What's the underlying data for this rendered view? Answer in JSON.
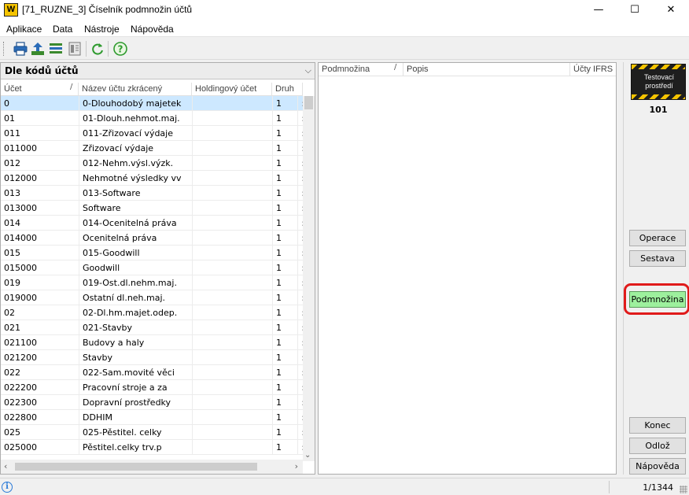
{
  "window": {
    "logo_text": "W",
    "title": "[71_RUZNE_3] Číselník podmnožin účtů",
    "minimize": "—",
    "maximize": "☐",
    "close": "✕"
  },
  "menu": [
    "Aplikace",
    "Data",
    "Nástroje",
    "Nápověda"
  ],
  "toolbar": {
    "icons": [
      "printer-icon",
      "export-icon",
      "list-icon",
      "document-icon",
      "refresh-icon",
      "help-icon"
    ]
  },
  "left": {
    "sort_label": "Dle kódů účtů",
    "columns": {
      "ucet": "Účet",
      "nazev": "Název účtu zkrácený",
      "holding": "Holdingový účet",
      "druh": "Druh"
    },
    "sort_mark": "/",
    "rows": [
      {
        "ucet": "0",
        "nazev": "0-Dlouhodobý majetek",
        "holding": "",
        "druh": "1",
        "extra": ":"
      },
      {
        "ucet": "01",
        "nazev": "01-Dlouh.nehmot.maj.",
        "holding": "",
        "druh": "1",
        "extra": ":"
      },
      {
        "ucet": "011",
        "nazev": "011-Zřizovací výdaje",
        "holding": "",
        "druh": "1",
        "extra": ":"
      },
      {
        "ucet": "011000",
        "nazev": "Zřizovací výdaje",
        "holding": "",
        "druh": "1",
        "extra": ":"
      },
      {
        "ucet": "012",
        "nazev": "012-Nehm.výsl.výzk.",
        "holding": "",
        "druh": "1",
        "extra": ":"
      },
      {
        "ucet": "012000",
        "nazev": "Nehmotné výsledky vv",
        "holding": "",
        "druh": "1",
        "extra": ":"
      },
      {
        "ucet": "013",
        "nazev": "013-Software",
        "holding": "",
        "druh": "1",
        "extra": ":"
      },
      {
        "ucet": "013000",
        "nazev": "Software",
        "holding": "",
        "druh": "1",
        "extra": ":"
      },
      {
        "ucet": "014",
        "nazev": "014-Ocenitelná práva",
        "holding": "",
        "druh": "1",
        "extra": ":"
      },
      {
        "ucet": "014000",
        "nazev": "Ocenitelná práva",
        "holding": "",
        "druh": "1",
        "extra": ":"
      },
      {
        "ucet": "015",
        "nazev": "015-Goodwill",
        "holding": "",
        "druh": "1",
        "extra": ":"
      },
      {
        "ucet": "015000",
        "nazev": "Goodwill",
        "holding": "",
        "druh": "1",
        "extra": ":"
      },
      {
        "ucet": "019",
        "nazev": "019-Ost.dl.nehm.maj.",
        "holding": "",
        "druh": "1",
        "extra": ":"
      },
      {
        "ucet": "019000",
        "nazev": "Ostatní dl.neh.maj.",
        "holding": "",
        "druh": "1",
        "extra": ":"
      },
      {
        "ucet": "02",
        "nazev": "02-Dl.hm.majet.odep.",
        "holding": "",
        "druh": "1",
        "extra": ":"
      },
      {
        "ucet": "021",
        "nazev": "021-Stavby",
        "holding": "",
        "druh": "1",
        "extra": ":"
      },
      {
        "ucet": "021100",
        "nazev": "Budovy a haly",
        "holding": "",
        "druh": "1",
        "extra": ":"
      },
      {
        "ucet": "021200",
        "nazev": "Stavby",
        "holding": "",
        "druh": "1",
        "extra": ":"
      },
      {
        "ucet": "022",
        "nazev": "022-Sam.movité věci",
        "holding": "",
        "druh": "1",
        "extra": ":"
      },
      {
        "ucet": "022200",
        "nazev": "Pracovní stroje a za",
        "holding": "",
        "druh": "1",
        "extra": ":"
      },
      {
        "ucet": "022300",
        "nazev": "Dopravní prostředky",
        "holding": "",
        "druh": "1",
        "extra": ":"
      },
      {
        "ucet": "022800",
        "nazev": "DDHIM",
        "holding": "",
        "druh": "1",
        "extra": ":"
      },
      {
        "ucet": "025",
        "nazev": "025-Pěstitel. celky",
        "holding": "",
        "druh": "1",
        "extra": ":"
      },
      {
        "ucet": "025000",
        "nazev": "Pěstitel.celky trv.p",
        "holding": "",
        "druh": "1",
        "extra": ":"
      }
    ]
  },
  "middle": {
    "columns": {
      "podmnozina": "Podmnožina",
      "popis": "Popis",
      "ucty_ifrs": "Účty IFRS"
    },
    "sort_mark": "/"
  },
  "right": {
    "env_badge": "Testovací prostředí",
    "env_number": "101",
    "buttons": {
      "operace": "Operace",
      "sestava": "Sestava",
      "podmnozina": "Podmnožina",
      "konec": "Konec",
      "odloz": "Odlož",
      "napoveda": "Nápověda"
    }
  },
  "status": {
    "info_icon": "i",
    "count": "1/1344"
  },
  "colors": {
    "selected_row": "#cde8ff",
    "highlight_button": "#9df09d",
    "annotation_ring": "#e01b1b",
    "badge_stripe": "#f5c400"
  }
}
